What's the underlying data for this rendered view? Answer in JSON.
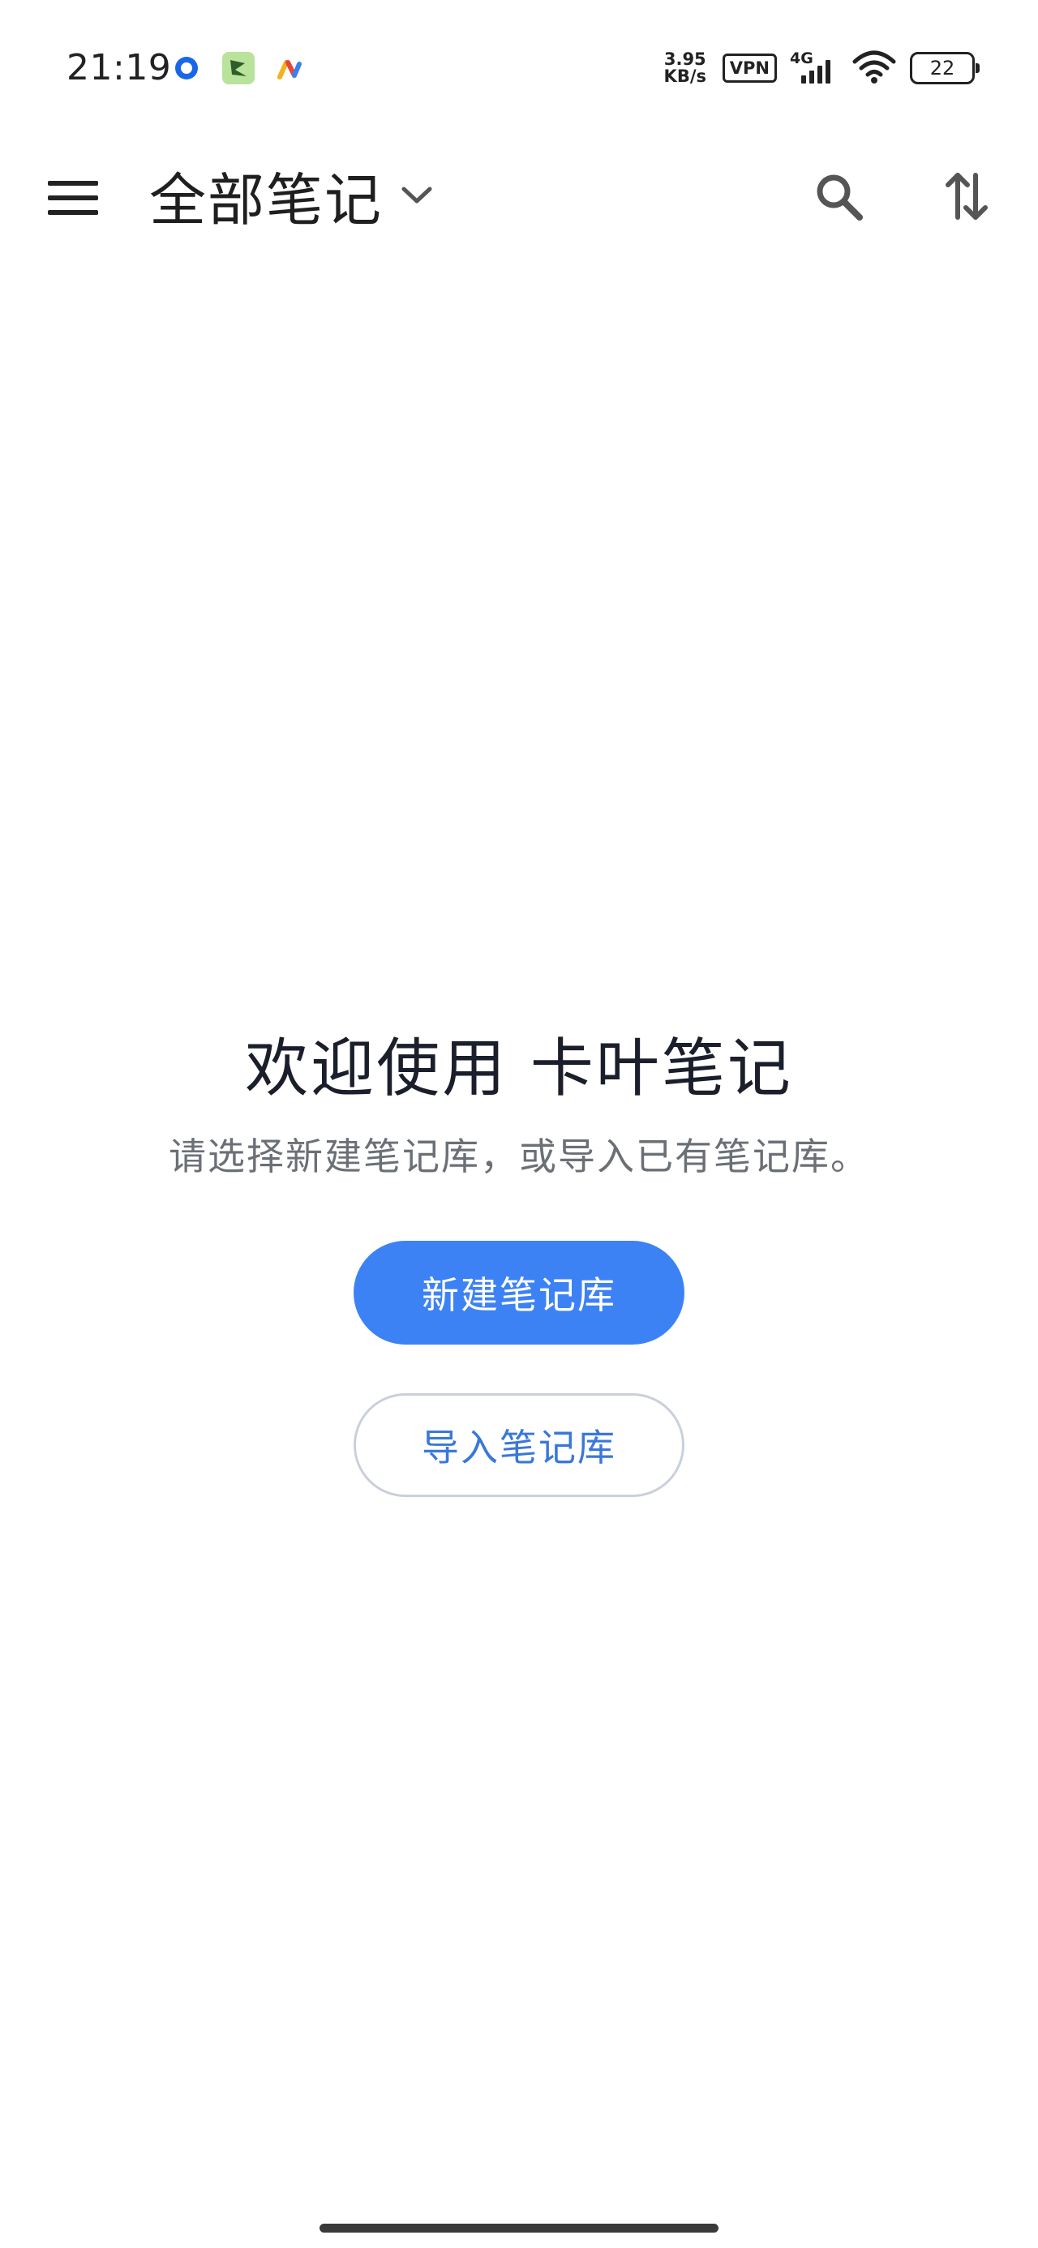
{
  "status_bar": {
    "time": "21:19",
    "net_speed_value": "3.95",
    "net_speed_unit": "KB/s",
    "vpn_label": "VPN",
    "network_type": "4G",
    "battery_level": "22",
    "notification_icons": [
      "blue-circle-app-icon",
      "green-app-icon",
      "multicolor-app-icon"
    ],
    "status_icons": [
      "signal-icon",
      "wifi-icon",
      "battery-icon"
    ]
  },
  "app_bar": {
    "title": "全部笔记",
    "icons": [
      "menu-icon",
      "chevron-down-icon",
      "search-icon",
      "sort-icon"
    ]
  },
  "empty_state": {
    "title": "欢迎使用 卡叶笔记",
    "subtitle": "请选择新建笔记库，或导入已有笔记库。",
    "create_button_label": "新建笔记库",
    "import_button_label": "导入笔记库"
  },
  "colors": {
    "primary": "#3d82f4",
    "secondary_text": "#3a78d8",
    "secondary_border": "#c9d0dc",
    "background": "#ffffff"
  }
}
